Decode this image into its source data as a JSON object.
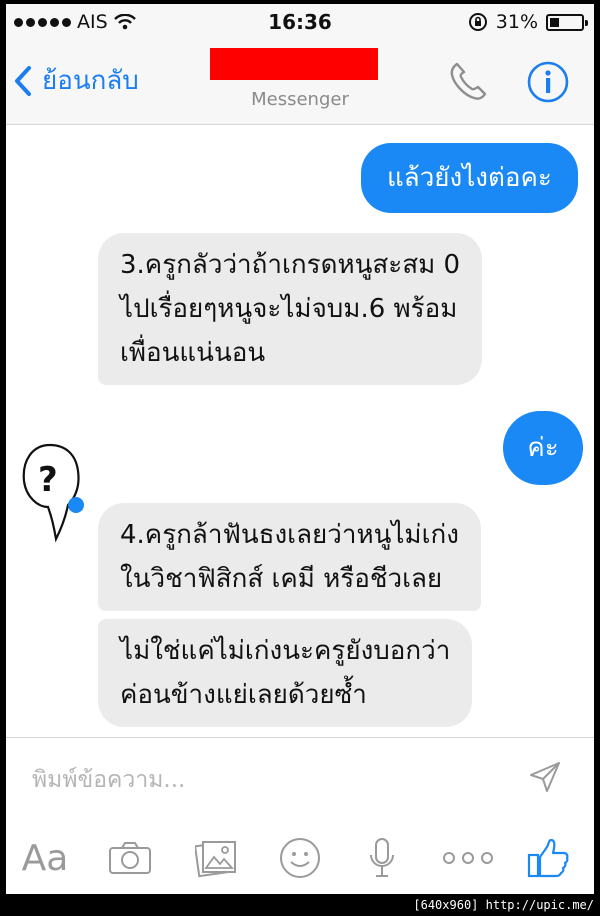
{
  "status_bar": {
    "carrier": "AIS",
    "time": "16:36",
    "battery_percent": "31%",
    "battery_level": 0.31
  },
  "nav": {
    "back_label": "ย้อนกลับ",
    "subtitle": "Messenger"
  },
  "messages": [
    {
      "from": "me",
      "lines": [
        "แล้วยังไงต่อคะ"
      ]
    },
    {
      "from": "them",
      "lines": [
        "3.ครูกลัวว่าถ้าเกรดหนูสะสม 0",
        "ไปเรื่อยๆหนูจะไม่จบม.6 พร้อม",
        "เพื่อนแน่นอน"
      ]
    },
    {
      "from": "me",
      "lines": [
        "ค่ะ"
      ]
    },
    {
      "from": "them",
      "lines": [
        "4.ครูกล้าฟันธงเลยว่าหนูไม่เก่ง",
        "ในวิชาฟิสิกส์ เคมี หรือชีวเลย"
      ]
    },
    {
      "from": "them",
      "lines": [
        "ไม่ใช่แค่ไม่เก่งนะครูยังบอกว่า",
        "ค่อนข้างแย่เลยด้วยซ้ำ"
      ]
    }
  ],
  "composer": {
    "placeholder": "พิมพ์ข้อความ...",
    "aa_label": "Aa"
  },
  "footer": {
    "watermark": "[640x960] http://upic.me/"
  },
  "colors": {
    "accent": "#1a88f5",
    "incoming_bubble": "#ebebeb",
    "redaction": "#ff0000"
  }
}
